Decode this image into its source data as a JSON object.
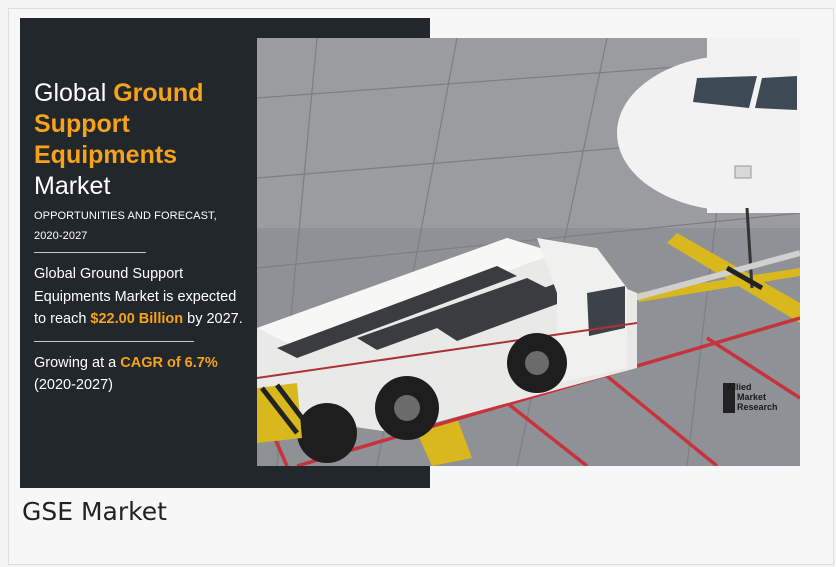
{
  "banner": {
    "title_line1_light": "Global",
    "title_line1_hl": "Ground",
    "title_line2": "Support",
    "title_line3": "Equipments",
    "title_line4": "Market",
    "subtitle_line1": "OPPORTUNITIES AND FORECAST,",
    "subtitle_line2": "2020-2027",
    "para1_a": "Global Ground Support Equipments Market is expected to reach ",
    "para1_hl": "$22.00 Billion",
    "para1_b": " by 2027.",
    "para2_a": "Growing at a ",
    "para2_hl": "CAGR of 6.7%",
    "para2_b": " (2020-2027)"
  },
  "photo": {
    "watermark_line1": "Allied",
    "watermark_line2": "Market",
    "watermark_line3": "Research"
  },
  "caption": "GSE Market",
  "colors": {
    "banner_bg": "#22272c",
    "highlight": "#f7a21b"
  }
}
